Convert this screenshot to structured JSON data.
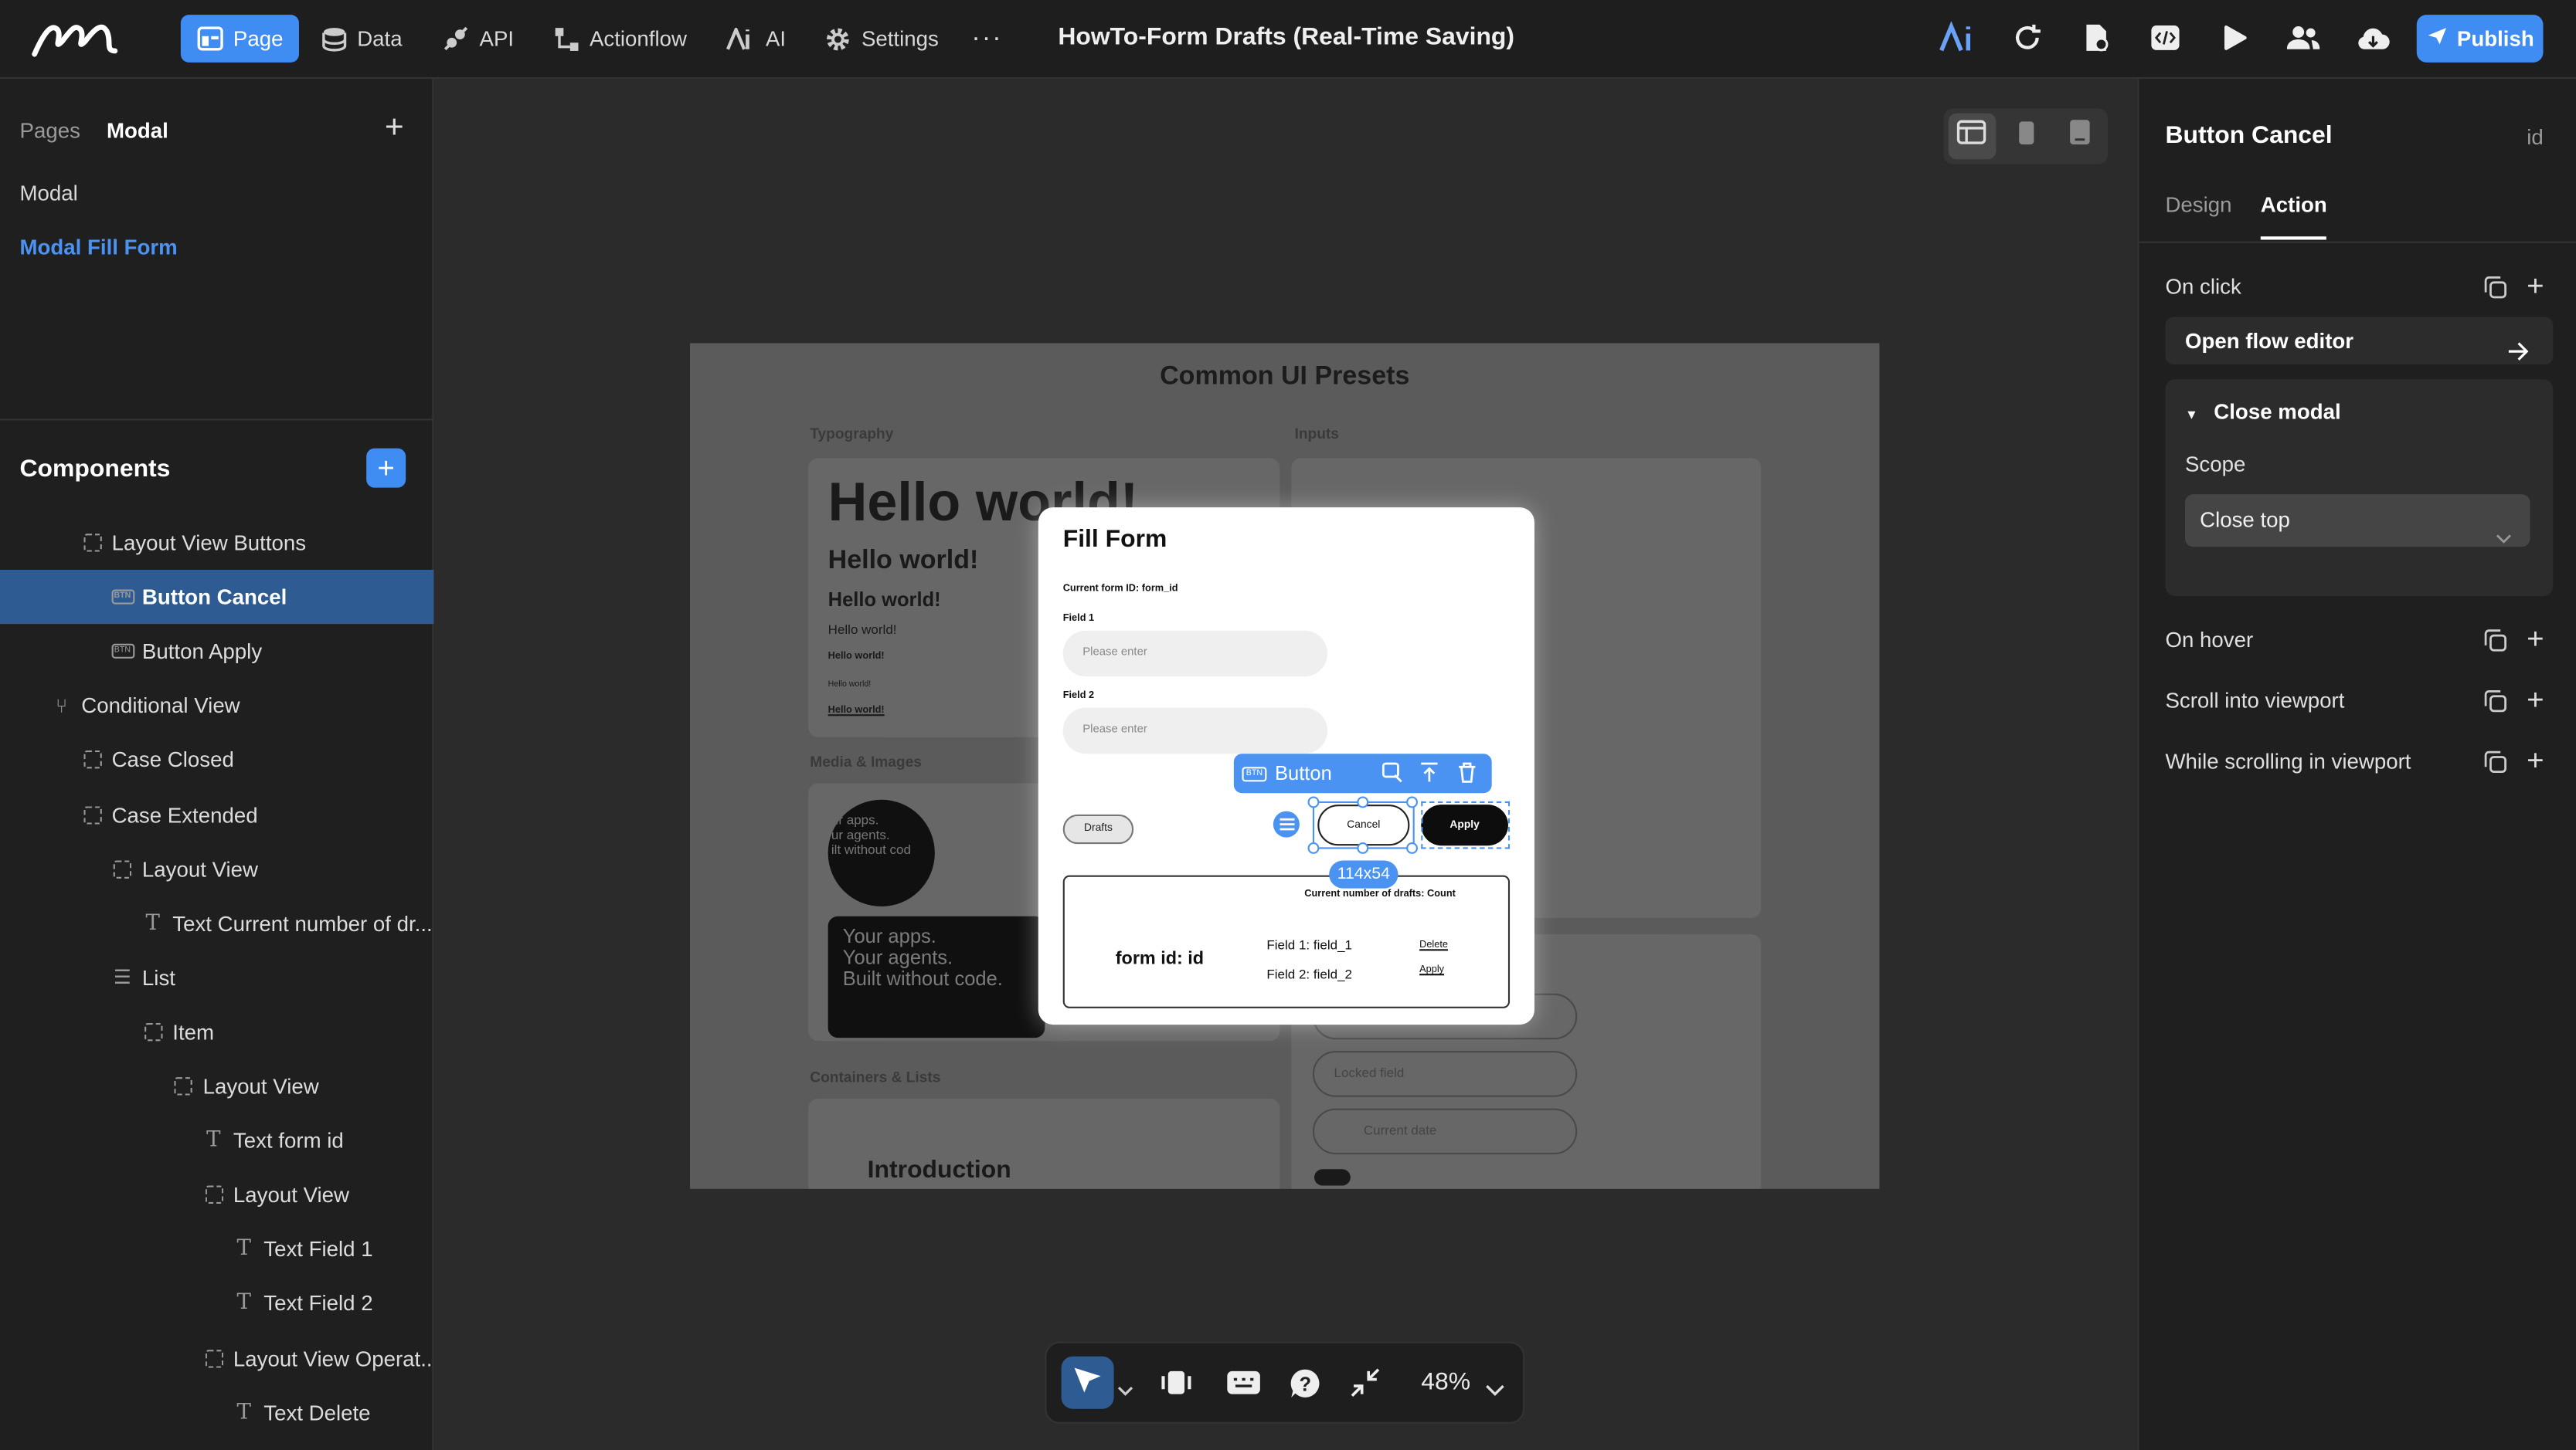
{
  "topbar": {
    "nav": [
      {
        "label": "Page",
        "icon": "page-icon",
        "active": true
      },
      {
        "label": "Data",
        "icon": "database-icon"
      },
      {
        "label": "API",
        "icon": "api-icon"
      },
      {
        "label": "Actionflow",
        "icon": "actionflow-icon"
      },
      {
        "label": "AI",
        "icon": "ai-icon"
      },
      {
        "label": "Settings",
        "icon": "gear-icon"
      }
    ],
    "more": "···",
    "title": "HowTo-Form Drafts (Real-Time Saving)",
    "tools": [
      "ai-logo-icon",
      "refresh-icon",
      "page-settings-icon",
      "code-icon",
      "play-icon",
      "users-icon",
      "cloud-icon"
    ],
    "publish_label": "Publish",
    "accent": "#3f8cf2"
  },
  "left": {
    "pages_tab": "Pages",
    "modal_tab": "Modal",
    "pages": [
      "Modal",
      "Modal Fill Form"
    ],
    "selected_page": "Modal Fill Form",
    "components_title": "Components",
    "tree": [
      {
        "label": "Layout View Buttons",
        "icon": "view",
        "depth": 2
      },
      {
        "label": "Button Cancel",
        "icon": "button",
        "depth": 3,
        "selected": true
      },
      {
        "label": "Button Apply",
        "icon": "button",
        "depth": 3
      },
      {
        "label": "Conditional View",
        "icon": "conditional",
        "depth": 1
      },
      {
        "label": "Case Closed",
        "icon": "view",
        "depth": 2
      },
      {
        "label": "Case Extended",
        "icon": "view",
        "depth": 2
      },
      {
        "label": "Layout View",
        "icon": "view",
        "depth": 3
      },
      {
        "label": "Text Current number of dr...",
        "icon": "text",
        "depth": 4
      },
      {
        "label": "List",
        "icon": "list",
        "depth": 3
      },
      {
        "label": "Item",
        "icon": "view",
        "depth": 4
      },
      {
        "label": "Layout View",
        "icon": "view",
        "depth": 5
      },
      {
        "label": "Text form id",
        "icon": "text",
        "depth": 6
      },
      {
        "label": "Layout View",
        "icon": "view",
        "depth": 6
      },
      {
        "label": "Text Field 1",
        "icon": "text",
        "depth": 7
      },
      {
        "label": "Text Field 2",
        "icon": "text",
        "depth": 7
      },
      {
        "label": "Layout View Operat...",
        "icon": "view",
        "depth": 6
      },
      {
        "label": "Text Delete",
        "icon": "text",
        "depth": 7
      }
    ]
  },
  "canvas": {
    "artboard": {
      "title": "Common UI Presets",
      "typography": "Typography",
      "inputs": "Inputs",
      "media": "Media & Images",
      "containers": "Containers & Lists",
      "hello_big": "Hello world!",
      "hello_lines": [
        "Hello world!",
        "Hello world!",
        "Hello world!",
        "Hello world!",
        "Hello world!",
        "Hello world!"
      ],
      "apps_lines": [
        "Your apps.",
        "Your agents.",
        "Built without code."
      ],
      "apps_small": [
        "ur apps.",
        "ur agents.",
        "ilt without cod"
      ],
      "intro": "Introduction",
      "locked": "Locked field",
      "current_date": "Current date"
    },
    "modal": {
      "title": "Fill Form",
      "current_id": "Current form ID: form_id",
      "field1_label": "Field 1",
      "field2_label": "Field 2",
      "placeholder": "Please enter",
      "drafts": "Drafts",
      "cancel": "Cancel",
      "apply": "Apply",
      "count": "Current number of drafts: Count",
      "form_id": "form id: id",
      "field1_value": "Field 1: field_1",
      "field2_value": "Field 2: field_2",
      "delete": "Delete",
      "apply_link": "Apply"
    },
    "selection": {
      "toolbar_label": "Button",
      "size": "114x54"
    },
    "zoom": "48%"
  },
  "right": {
    "title": "Button Cancel",
    "id_label": "id",
    "tabs": [
      "Design",
      "Action"
    ],
    "active_tab": "Action",
    "on_click": "On click",
    "open_flow": "Open flow editor",
    "action_name": "Close modal",
    "scope_label": "Scope",
    "scope_value": "Close top",
    "events": [
      "On hover",
      "Scroll into viewport",
      "While scrolling in viewport"
    ]
  }
}
